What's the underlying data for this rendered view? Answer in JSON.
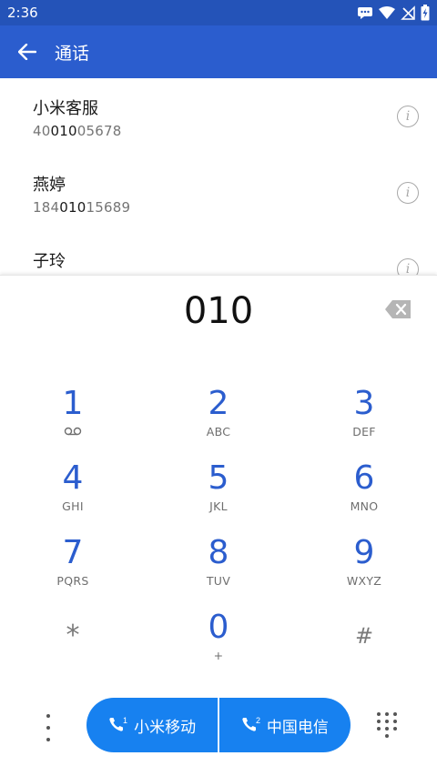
{
  "status_bar": {
    "time": "2:36"
  },
  "app_bar": {
    "title": "通话"
  },
  "contacts": [
    {
      "name": "小米客服",
      "number_pre": "40",
      "number_match": "010",
      "number_post": "05678"
    },
    {
      "name": "燕婷",
      "number_pre": "184",
      "number_match": "010",
      "number_post": "15689"
    },
    {
      "name": "子玲",
      "number_pre": "",
      "number_match": "",
      "number_post": ""
    }
  ],
  "dialpad": {
    "digits": "010",
    "keys": [
      {
        "digit": "1",
        "letters": ""
      },
      {
        "digit": "2",
        "letters": "ABC"
      },
      {
        "digit": "3",
        "letters": "DEF"
      },
      {
        "digit": "4",
        "letters": "GHI"
      },
      {
        "digit": "5",
        "letters": "JKL"
      },
      {
        "digit": "6",
        "letters": "MNO"
      },
      {
        "digit": "7",
        "letters": "PQRS"
      },
      {
        "digit": "8",
        "letters": "TUV"
      },
      {
        "digit": "9",
        "letters": "WXYZ"
      },
      {
        "digit": "*",
        "letters": ""
      },
      {
        "digit": "0",
        "letters": "+"
      },
      {
        "digit": "#",
        "letters": ""
      }
    ]
  },
  "call_buttons": {
    "sim1_label": "小米移动",
    "sim1_index": "1",
    "sim2_label": "中国电信",
    "sim2_index": "2"
  },
  "colors": {
    "accent": "#2b5dce",
    "call": "#1781f0"
  }
}
